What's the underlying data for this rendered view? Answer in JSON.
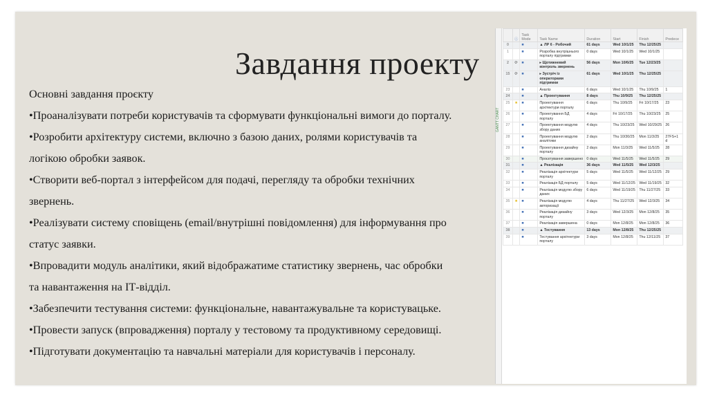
{
  "slide": {
    "title": "Завдання проекту",
    "lines": [
      "Основні завдання проєкту",
      "•Проаналізувати потреби користувачів та сформувати функціональні вимоги до порталу.",
      "•Розробити архітектуру системи, включно з базою даних, ролями користувачів та",
      "логікою обробки заявок.",
      "•Створити веб-портал з інтерфейсом для подачі, перегляду та обробки технічних",
      "звернень.",
      "•Реалізувати систему сповіщень (email/внутрішні повідомлення) для інформування про",
      "статус заявки.",
      "•Впровадити модуль аналітики, який відображатиме статистику звернень, час обробки",
      "та навантаження на ІТ-відділ.",
      "•Забезпечити тестування системи: функціональне, навантажувальне та користувацьке.",
      "•Провести запуск (впровадження) порталу у тестовому та продуктивному середовищі.",
      "•Підготувати документацію та навчальні матеріали для користувачів і персоналу."
    ]
  },
  "gantt": {
    "side_label": "GANTT CHART",
    "headers": [
      "",
      "",
      "Task Mode",
      "Task Name",
      "Duration",
      "Start",
      "Finish",
      "Predece"
    ],
    "rows": [
      {
        "n": "0",
        "icon": "",
        "name": "▲ ЛР 6 - Робочий",
        "dur": "61 days",
        "start": "Wed 10/1/25",
        "finish": "Thu 12/25/25",
        "pred": "",
        "cls": "sum"
      },
      {
        "n": "1",
        "icon": "",
        "name": "Розробка внутрішнього порталу підтримки",
        "dur": "0 days",
        "start": "Wed 10/1/25",
        "finish": "Wed 10/1/25",
        "pred": "",
        "cls": ""
      },
      {
        "n": "2",
        "icon": "⟳",
        "name": "▸ Щотижневий контроль звернень",
        "dur": "56 days",
        "start": "Mon 10/6/25",
        "finish": "Tue 12/23/25",
        "pred": "",
        "cls": "sum"
      },
      {
        "n": "15",
        "icon": "⟳",
        "name": "▸ Зустріч із операторами підтримки",
        "dur": "61 days",
        "start": "Wed 10/1/25",
        "finish": "Thu 12/25/25",
        "pred": "",
        "cls": "sum"
      },
      {
        "n": "23",
        "icon": "",
        "name": "Аналіз",
        "dur": "6 days",
        "start": "Wed 10/1/25",
        "finish": "Thu 10/9/25",
        "pred": "1",
        "cls": ""
      },
      {
        "n": "24",
        "icon": "",
        "name": "▲ Проектування",
        "dur": "8 days",
        "start": "Thu 10/9/25",
        "finish": "Thu 12/25/25",
        "pred": "",
        "cls": "sum"
      },
      {
        "n": "25",
        "icon": "★",
        "name": "Проектування архітектури порталу",
        "dur": "6 days",
        "start": "Thu 10/9/25",
        "finish": "Fri 10/17/25",
        "pred": "23",
        "cls": ""
      },
      {
        "n": "26",
        "icon": "",
        "name": "Проектування БД порталу",
        "dur": "4 days",
        "start": "Fri 10/17/25",
        "finish": "Thu 10/23/25",
        "pred": "25",
        "cls": ""
      },
      {
        "n": "27",
        "icon": "",
        "name": "Проектування модулю збору даних",
        "dur": "4 days",
        "start": "Thu 10/23/25",
        "finish": "Wed 10/29/25",
        "pred": "26",
        "cls": ""
      },
      {
        "n": "28",
        "icon": "",
        "name": "Проектування модулю аналітики",
        "dur": "2 days",
        "start": "Thu 10/30/25",
        "finish": "Mon 11/3/25",
        "pred": "27FS+1 d",
        "cls": ""
      },
      {
        "n": "29",
        "icon": "",
        "name": "Проектування дизайну порталу",
        "dur": "2 days",
        "start": "Mon 11/3/25",
        "finish": "Wed 11/5/25",
        "pred": "28",
        "cls": ""
      },
      {
        "n": "30",
        "icon": "",
        "name": "Проєктування завершено",
        "dur": "0 days",
        "start": "Wed 11/5/25",
        "finish": "Wed 11/5/25",
        "pred": "29",
        "cls": "sel"
      },
      {
        "n": "31",
        "icon": "",
        "name": "▲ Реалізація",
        "dur": "36 days",
        "start": "Wed 11/5/25",
        "finish": "Wed 12/3/25",
        "pred": "",
        "cls": "sum"
      },
      {
        "n": "32",
        "icon": "",
        "name": "Реалізація архітектури порталу",
        "dur": "5 days",
        "start": "Wed 11/5/25",
        "finish": "Wed 11/12/25",
        "pred": "29",
        "cls": ""
      },
      {
        "n": "33",
        "icon": "",
        "name": "Реалізація БД порталу",
        "dur": "5 days",
        "start": "Wed 11/12/25",
        "finish": "Wed 11/19/25",
        "pred": "32",
        "cls": ""
      },
      {
        "n": "34",
        "icon": "",
        "name": "Реалізація модулю збору даних",
        "dur": "6 days",
        "start": "Wed 11/19/25",
        "finish": "Thu 11/27/25",
        "pred": "33",
        "cls": ""
      },
      {
        "n": "35",
        "icon": "★",
        "name": "Реалізація модулю авторизації",
        "dur": "4 days",
        "start": "Thu 11/27/25",
        "finish": "Wed 12/3/25",
        "pred": "34",
        "cls": ""
      },
      {
        "n": "36",
        "icon": "",
        "name": "Реалізація дизайну порталу",
        "dur": "3 days",
        "start": "Wed 12/3/25",
        "finish": "Mon 12/8/25",
        "pred": "35",
        "cls": ""
      },
      {
        "n": "37",
        "icon": "",
        "name": "Реалізація завершена",
        "dur": "0 days",
        "start": "Mon 12/8/25",
        "finish": "Mon 12/8/25",
        "pred": "36",
        "cls": ""
      },
      {
        "n": "38",
        "icon": "",
        "name": "▲ Тестування",
        "dur": "13 days",
        "start": "Mon 12/8/25",
        "finish": "Thu 12/25/25",
        "pred": "",
        "cls": "sum"
      },
      {
        "n": "39",
        "icon": "",
        "name": "Тестування архітектури порталу",
        "dur": "3 days",
        "start": "Mon 12/8/25",
        "finish": "Thu 12/11/25",
        "pred": "37",
        "cls": ""
      }
    ]
  }
}
